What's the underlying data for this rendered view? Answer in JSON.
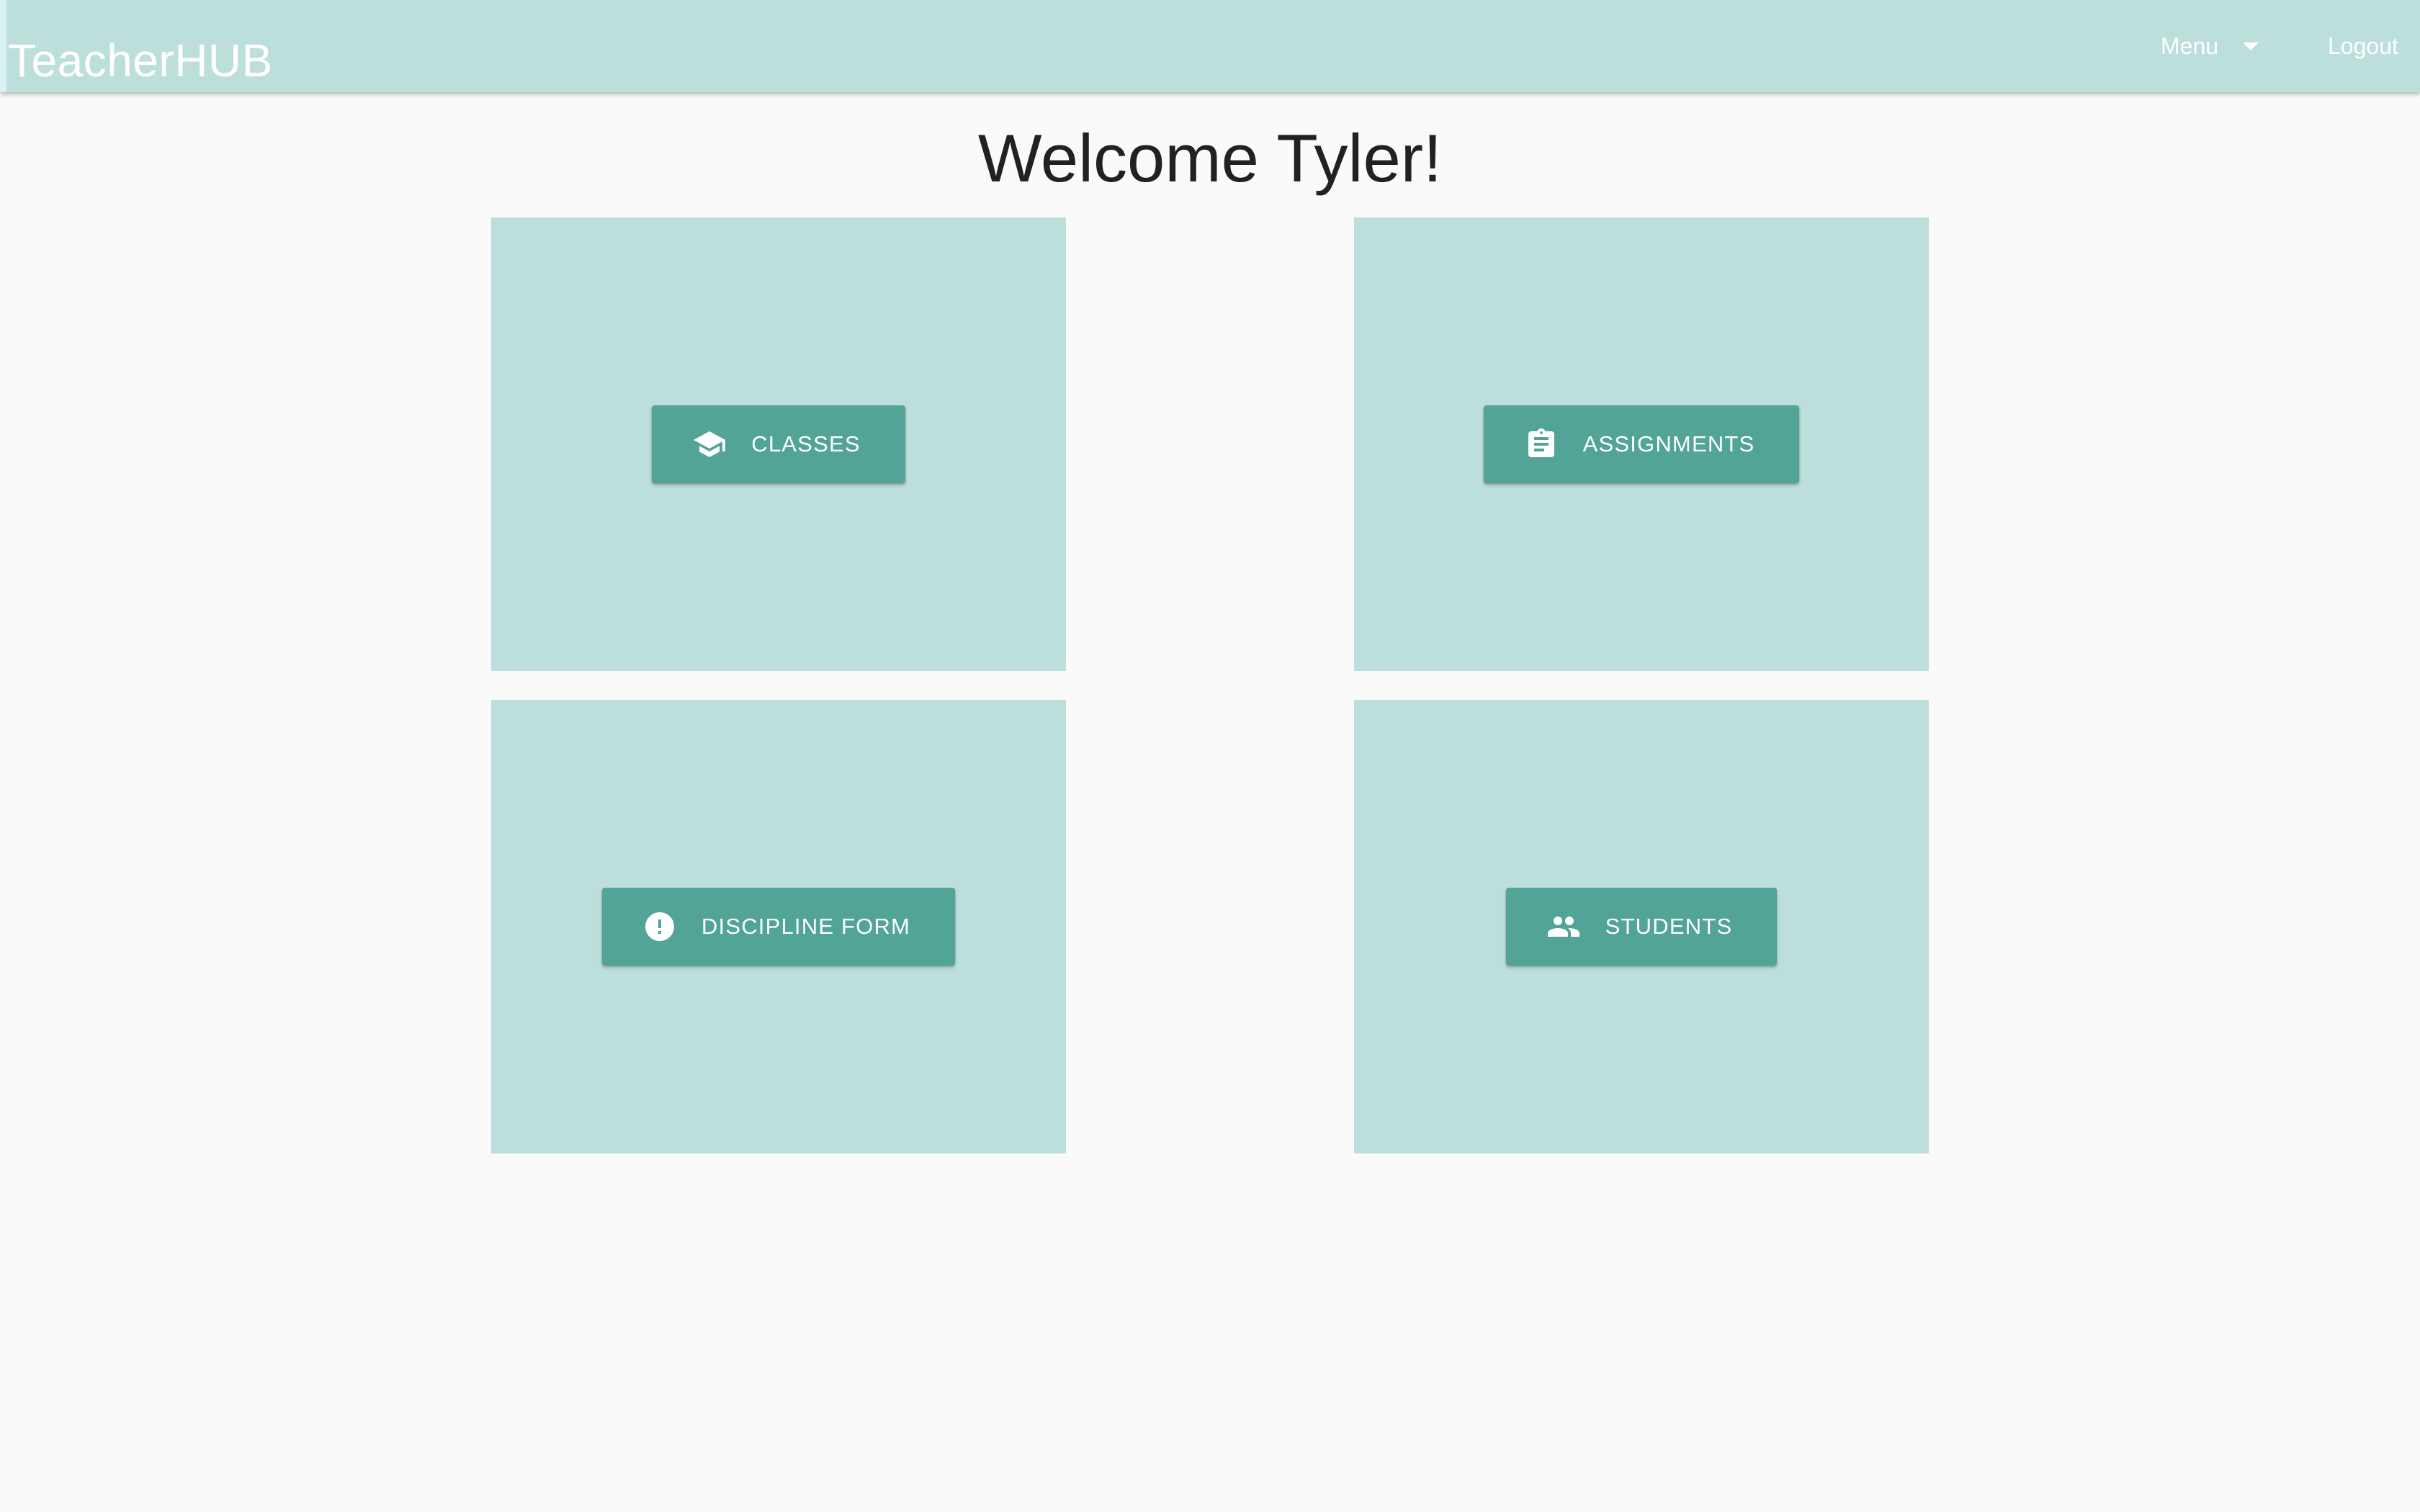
{
  "header": {
    "brand": "TeacherHUB",
    "menu_label": "Menu",
    "logout_label": "Logout",
    "background_color": "#bcdfdc"
  },
  "welcome": {
    "title": "Welcome Tyler!"
  },
  "tiles": [
    {
      "label": "CLASSES",
      "icon": "school-icon"
    },
    {
      "label": "ASSIGNMENTS",
      "icon": "clipboard-icon"
    },
    {
      "label": "DISCIPLINE FORM",
      "icon": "alert-circle-icon"
    },
    {
      "label": "STUDENTS",
      "icon": "people-icon"
    }
  ],
  "colors": {
    "tile_background": "#bcdfdc",
    "button_background": "#52a497",
    "page_background": "#fafafa"
  }
}
